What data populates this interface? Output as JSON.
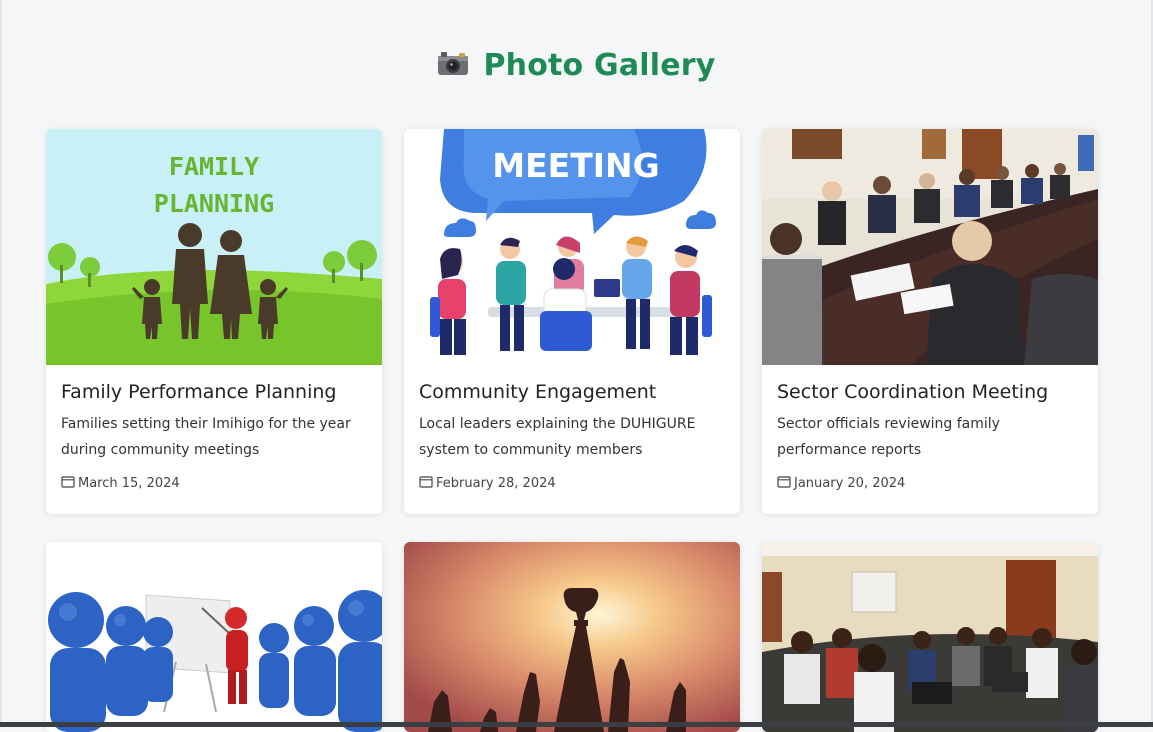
{
  "header": {
    "title": "Photo Gallery",
    "icon": "camera-icon"
  },
  "colors": {
    "accent": "#1e8a55",
    "background": "#f4f6f8"
  },
  "gallery": {
    "items": [
      {
        "title": "Family Performance Planning",
        "description": "Families setting their Imihigo for the year during community meetings",
        "date": "March 15, 2024",
        "image_text": "FAMILY PLANNING",
        "image_text_line1": "FAMILY",
        "image_text_line2": "PLANNING"
      },
      {
        "title": "Community Engagement",
        "description": "Local leaders explaining the DUHIGURE system to community members",
        "date": "February 28, 2024",
        "image_text": "MEETING"
      },
      {
        "title": "Sector Coordination Meeting",
        "description": "Sector officials reviewing family performance reports",
        "date": "January 20, 2024"
      },
      {
        "image": "presentation-illustration"
      },
      {
        "image": "trophy-celebration-photo"
      },
      {
        "image": "office-meeting-photo"
      }
    ]
  }
}
